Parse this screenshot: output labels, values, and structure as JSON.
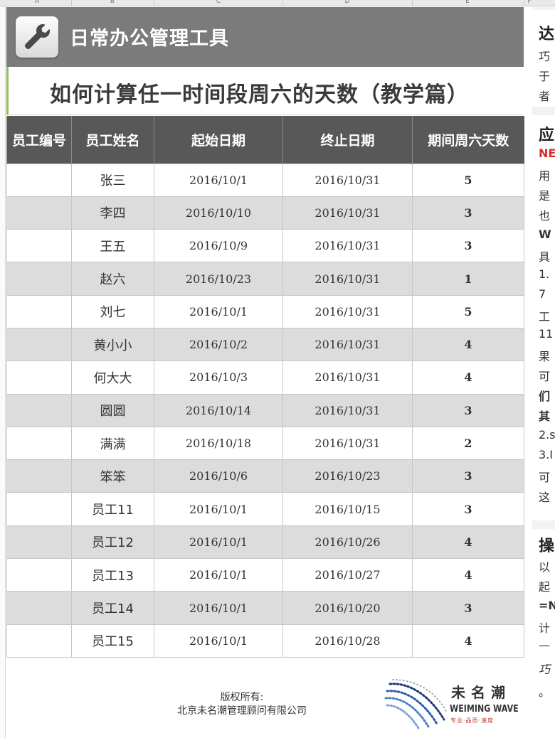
{
  "column_letters": [
    "A",
    "B",
    "C",
    "D",
    "E",
    "F"
  ],
  "banner": {
    "title": "日常办公管理工具",
    "icon": "wrench-icon"
  },
  "page_title": "如何计算任一时间段周六的天数（教学篇）",
  "table": {
    "headers": [
      "员工编号",
      "员工姓名",
      "起始日期",
      "终止日期",
      "期间周六天数"
    ],
    "rows": [
      {
        "id": "",
        "name": "张三",
        "start": "2016/10/1",
        "end": "2016/10/31",
        "saturdays": "5"
      },
      {
        "id": "",
        "name": "李四",
        "start": "2016/10/10",
        "end": "2016/10/31",
        "saturdays": "3"
      },
      {
        "id": "",
        "name": "王五",
        "start": "2016/10/9",
        "end": "2016/10/31",
        "saturdays": "3"
      },
      {
        "id": "",
        "name": "赵六",
        "start": "2016/10/23",
        "end": "2016/10/31",
        "saturdays": "1"
      },
      {
        "id": "",
        "name": "刘七",
        "start": "2016/10/1",
        "end": "2016/10/31",
        "saturdays": "5"
      },
      {
        "id": "",
        "name": "黄小小",
        "start": "2016/10/2",
        "end": "2016/10/31",
        "saturdays": "4"
      },
      {
        "id": "",
        "name": "何大大",
        "start": "2016/10/3",
        "end": "2016/10/31",
        "saturdays": "4"
      },
      {
        "id": "",
        "name": "圆圆",
        "start": "2016/10/14",
        "end": "2016/10/31",
        "saturdays": "3"
      },
      {
        "id": "",
        "name": "满满",
        "start": "2016/10/18",
        "end": "2016/10/31",
        "saturdays": "2"
      },
      {
        "id": "",
        "name": "笨笨",
        "start": "2016/10/6",
        "end": "2016/10/23",
        "saturdays": "3"
      },
      {
        "id": "",
        "name": "员工11",
        "start": "2016/10/1",
        "end": "2016/10/15",
        "saturdays": "3"
      },
      {
        "id": "",
        "name": "员工12",
        "start": "2016/10/1",
        "end": "2016/10/26",
        "saturdays": "4"
      },
      {
        "id": "",
        "name": "员工13",
        "start": "2016/10/1",
        "end": "2016/10/27",
        "saturdays": "4"
      },
      {
        "id": "",
        "name": "员工14",
        "start": "2016/10/1",
        "end": "2016/10/20",
        "saturdays": "3"
      },
      {
        "id": "",
        "name": "员工15",
        "start": "2016/10/1",
        "end": "2016/10/28",
        "saturdays": "4"
      }
    ]
  },
  "footer": {
    "copyright_line1": "版权所有:",
    "copyright_line2": "北京未名潮管理顾问有限公司",
    "logo_cn": "未名潮",
    "logo_en": "WEIMING WAVE",
    "logo_sub": "专业·品质·速度"
  },
  "side_panel_fragments": [
    "达",
    "巧",
    "于",
    "者",
    "应",
    "NE",
    "用",
    "是",
    "也",
    "W",
    "具",
    "1.",
    "7",
    "工",
    "11",
    "果",
    "可",
    "们",
    "其",
    "2.s",
    "3.I",
    "可",
    "这",
    "操",
    "以",
    "起",
    "=N",
    "计",
    "—",
    "巧",
    "。"
  ],
  "colors": {
    "banner": "#7b7b7b",
    "header": "#585858",
    "alt_row": "#dcdcdc",
    "accent_green": "#8fbf62",
    "red": "#d62b2b"
  }
}
